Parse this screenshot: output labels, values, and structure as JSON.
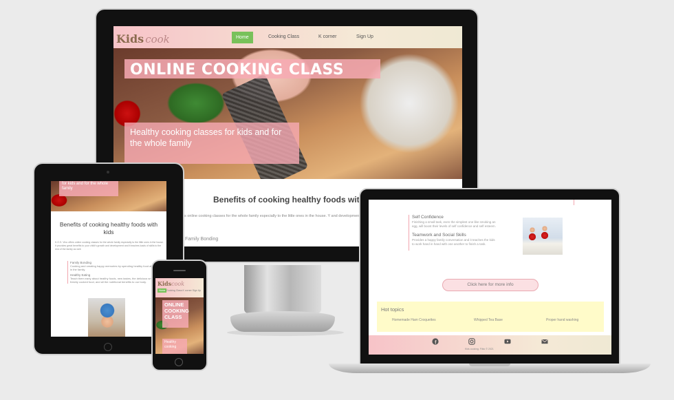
{
  "desktop": {
    "logo_main": "Kids",
    "logo_script": "cook",
    "nav": [
      "Home",
      "Cooking Class",
      "K corner",
      "Sign Up"
    ],
    "hero_title": "ONLINE COOKING CLASS",
    "hero_subtitle": "Healthy cooking classes for kids and for the whole family",
    "benefits_heading": "Benefits of cooking healthy foods with kids",
    "benefits_text": "es online cooking classes for the whole family especially to the little ones in the house. Y and development and it teaches loads of skills to the rest of the family as well.",
    "first_benefit": "Family Bonding"
  },
  "tablet": {
    "hero_text": "for kids and for the whole family",
    "benefits_heading": "Benefits of cooking healthy foods with kids",
    "intro": "K.O.S. Vino offers online cooking classes for the whole family especially to the little ones in the house. It provides great benefits to your child's growth and development and it teaches loads of skills to the rest of the family as well.",
    "items": [
      {
        "title": "Family Bonding",
        "text": "Cooking and creating happy memories by spending healthy food all together in the family."
      },
      {
        "title": "Healthy Eating",
        "text": "Teach them early about healthy foods, new tastes, the delicious smell of freshly cooked food, and all the nutritional benefits to our body."
      }
    ]
  },
  "phone": {
    "logo_main": "Kids",
    "logo_script": "cook",
    "nav_home": "Home",
    "nav_rest": "Cooking Class  K corner  Sign Up",
    "hero_title": "ONLINE COOKING CLASS",
    "hero_subtitle": "Healthy cooking"
  },
  "laptop": {
    "items": [
      {
        "title": "Self Confidence",
        "text": "Finishing a small task, even the simplest one like smoking an egg, will boost their levels of self confidence and self esteem."
      },
      {
        "title": "Teamwork and Social Skills",
        "text": "Provides a happy family conversation and it teaches the kids to work hand in hand with one another to finish a task."
      }
    ],
    "more_info_button": "Click here for more info",
    "hot_topics_title": "Hot topics",
    "hot_topics": [
      "Homemade Ham Croquettes",
      "Whipped Tea Base",
      "Proper hand washing"
    ],
    "footer_icons": [
      "facebook-icon",
      "instagram-icon",
      "youtube-icon",
      "email-icon"
    ],
    "copyright": "Kids cooking. Fibio  © 2021"
  }
}
